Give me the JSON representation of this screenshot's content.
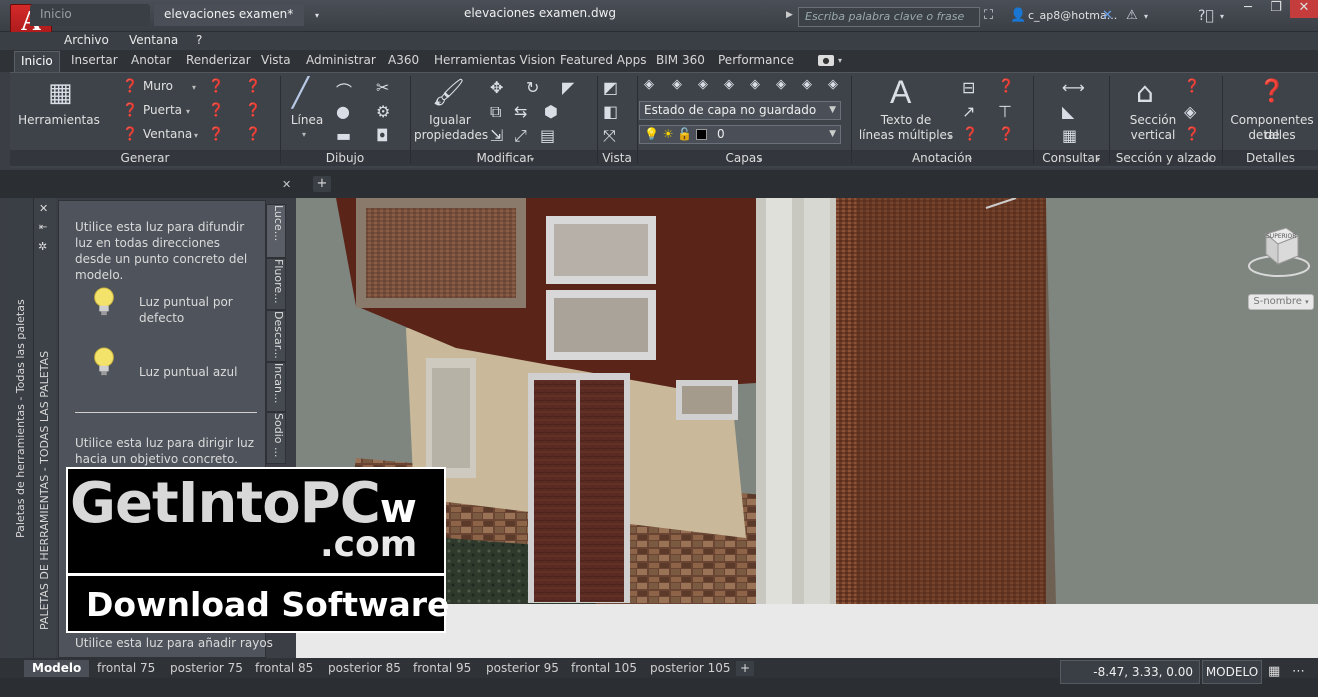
{
  "app": {
    "button_letter": "A",
    "button_sub": "A",
    "document_title": "elevaciones examen.dwg",
    "search_placeholder": "Escriba palabra clave o frase",
    "user": "c_ap8@hotma...",
    "accent_color": "#c41e1e"
  },
  "menu": [
    "Archivo",
    "Ventana",
    "?"
  ],
  "ribbon_tabs": [
    "Inicio",
    "Insertar",
    "Anotar",
    "Renderizar",
    "Vista",
    "Administrar",
    "A360",
    "Herramientas Vision",
    "Featured Apps",
    "BIM 360",
    "Performance"
  ],
  "ribbon": {
    "generar": {
      "title": "Generar",
      "herramientas": "Herramientas",
      "muro": "Muro",
      "puerta": "Puerta",
      "ventana": "Ventana"
    },
    "dibujo": {
      "title": "Dibujo",
      "linea": "Línea"
    },
    "modificar": {
      "title": "Modificar",
      "igualar_1": "Igualar",
      "igualar_2": "propiedades"
    },
    "vista": {
      "title": "Vista"
    },
    "capas": {
      "title": "Capas",
      "layer_state": "Estado de capa no guardado",
      "current_layer": "0"
    },
    "anotacion": {
      "title": "Anotación",
      "texto_1": "Texto de",
      "texto_2": "líneas múltiples"
    },
    "consultar": {
      "title": "Consultar"
    },
    "seccion": {
      "title": "Sección y alzado",
      "label_1": "Sección",
      "label_2": "vertical"
    },
    "detalles": {
      "title": "Detalles",
      "label_1": "Componentes de",
      "label_2": "detalles"
    }
  },
  "file_tabs": {
    "start": "Inicio",
    "active": "elevaciones examen*"
  },
  "palette": {
    "strip_title": "Paletas de herramientas - Todas las paletas",
    "strip_title_2": "PALETAS DE HERRAMIENTAS - TODAS LAS PALETAS",
    "intro_text": "Utilice esta luz para difundir luz en todas direcciones desde un punto concreto del modelo.",
    "item_1_line1": "Luz puntual por",
    "item_1_line2": "defecto",
    "item_2": "Luz puntual azul",
    "spot_text": "Utilice esta luz para dirigir luz hacia un objetivo concreto.",
    "bottom_text": "Utilice esta luz para añadir rayos",
    "tabs": [
      "Luce...",
      "Fluore...",
      "Descar...",
      "Incan...",
      "Sodio ..."
    ]
  },
  "watermark": {
    "line1_a": "GetInto",
    "line1_b": "PC",
    "line1_c": "w",
    "line2": ".com",
    "line3": "Download Software"
  },
  "viewport": {
    "wcs": "S-nombre",
    "cube_label": "SUPERIOR"
  },
  "layout_tabs": [
    "Modelo",
    "frontal 75",
    "posterior 75",
    "frontal 85",
    "posterior 85",
    "frontal 95",
    "posterior 95",
    "frontal 105",
    "posterior 105"
  ],
  "status": {
    "coords": "-8.47, 3.33, 0.00",
    "space": "MODELO"
  }
}
